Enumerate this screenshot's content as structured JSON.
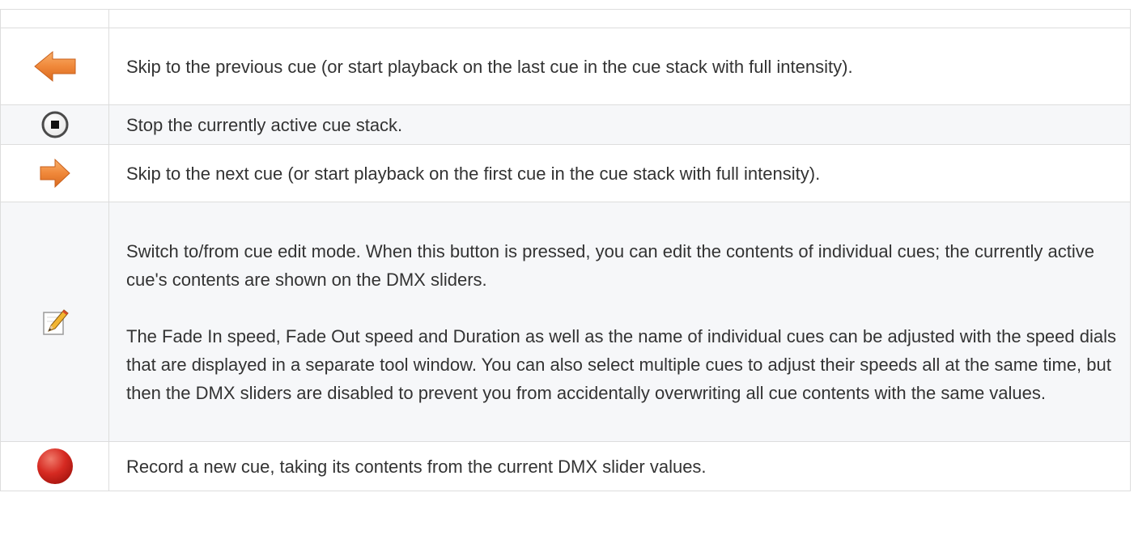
{
  "table": {
    "header": [
      "",
      ""
    ],
    "rows": [
      {
        "icon": "arrow-left-icon",
        "text": "Skip to the previous cue (or start playback on the last cue in the cue stack with full intensity)."
      },
      {
        "icon": "stop-icon",
        "text": "Stop the currently active cue stack."
      },
      {
        "icon": "arrow-right-icon",
        "text": "Skip to the next cue (or start playback on the first cue in the cue stack with full intensity)."
      },
      {
        "icon": "edit-pencil-icon",
        "paragraphs": [
          "Switch to/from cue edit mode. When this button is pressed, you can edit the contents of individual cues; the currently active cue's contents are shown on the DMX sliders.",
          "The Fade In speed, Fade Out speed and Duration as well as the name of individual cues can be adjusted with the speed dials that are displayed in a separate tool window. You can also select multiple cues to adjust their speeds all at the same time, but then the DMX sliders are disabled to prevent you from accidentally overwriting all cue contents with the same values."
        ]
      },
      {
        "icon": "record-icon",
        "text": "Record a new cue, taking its contents from the current DMX slider values."
      }
    ]
  },
  "colors": {
    "arrow": "#f0883a",
    "record": "#d62a22",
    "row_shade": "#f6f7f9",
    "border": "#dddddd",
    "text": "#333333"
  }
}
